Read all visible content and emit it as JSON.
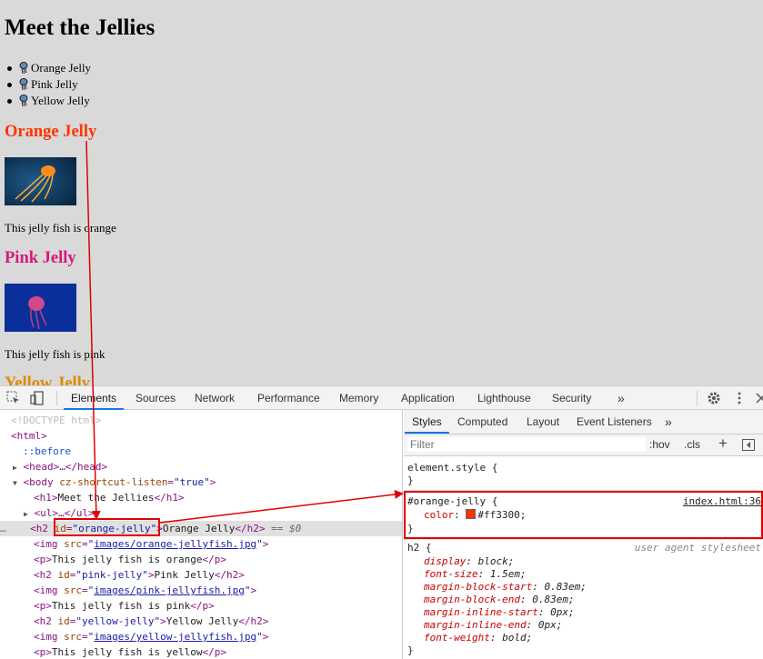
{
  "preview": {
    "title": "Meet the Jellies",
    "list": [
      "Orange Jelly",
      "Pink Jelly",
      "Yellow Jelly"
    ],
    "sections": [
      {
        "heading": "Orange Jelly",
        "color": "#ff3300",
        "caption": "This jelly fish is orange"
      },
      {
        "heading": "Pink Jelly",
        "color": "#d6197a",
        "caption": "This jelly fish is pink"
      },
      {
        "heading": "Yellow Jelly",
        "color": "#e08a00"
      }
    ]
  },
  "devtools": {
    "main_tabs": [
      "Elements",
      "Sources",
      "Network",
      "Performance",
      "Memory",
      "Application",
      "Lighthouse",
      "Security",
      "»"
    ],
    "active_tab": "Elements",
    "dom": {
      "doctype": "<!DOCTYPE html>",
      "html_open": "<html>",
      "before": "::before",
      "head": "<head>…</head>",
      "body_tag": "<body",
      "body_attr": "cz-shortcut-listen",
      "body_val": "\"true\"",
      "h1_open": "<h1>",
      "h1_text": "Meet the Jellies",
      "h1_close": "</h1>",
      "ul": "<ul>…</ul>",
      "h2_open": "<h2",
      "h2_attr": "id",
      "h2_val": "\"orange-jelly\"",
      "h2_text": "Orange Jelly",
      "h2_close": "</h2>",
      "selected_marker": "== $0",
      "img_orange": "images/orange-jellyfish.jpg",
      "p_orange": "This jelly fish is orange",
      "h2_pink_val": "\"pink-jelly\"",
      "h2_pink_text": "Pink Jelly",
      "img_pink": "images/pink-jellyfish.jpg",
      "p_pink": "This jelly fish is pink",
      "h2_yellow_val": "\"yellow-jelly\"",
      "h2_yellow_text": "Yellow Jelly",
      "img_yellow": "images/yellow-jellyfish.jpg",
      "p_yellow": "This jelly fish is yellow"
    },
    "styles_tabs": [
      "Styles",
      "Computed",
      "Layout",
      "Event Listeners",
      "»"
    ],
    "filter_placeholder": "Filter",
    "hov": ":hov",
    "cls": ".cls",
    "plus": "+",
    "element_style": "element.style {",
    "close_brace": "}",
    "rule_selector": "#orange-jelly {",
    "rule_source": "index.html:36",
    "rule_prop": "color",
    "rule_value": "#ff3300;",
    "ua_selector": "h2 {",
    "ua_source": "user agent stylesheet",
    "ua_props": [
      [
        "display",
        "block;"
      ],
      [
        "font-size",
        "1.5em;"
      ],
      [
        "margin-block-start",
        "0.83em;"
      ],
      [
        "margin-block-end",
        "0.83em;"
      ],
      [
        "margin-inline-start",
        "0px;"
      ],
      [
        "margin-inline-end",
        "0px;"
      ],
      [
        "font-weight",
        "bold;"
      ]
    ],
    "annotation_color": "#e00000"
  }
}
